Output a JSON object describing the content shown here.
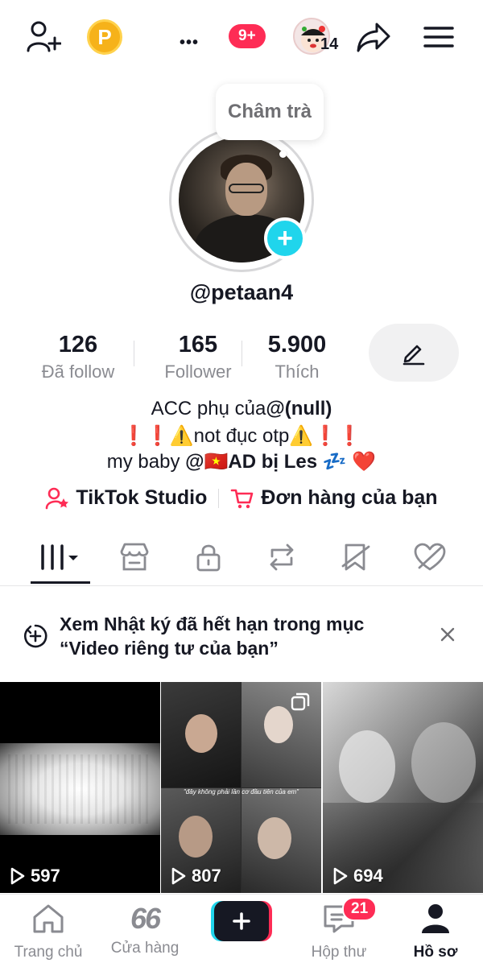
{
  "topbar": {
    "coin_letter": "P",
    "more_label": "•••",
    "notif_badge": "9+",
    "story_count": "14"
  },
  "profile": {
    "bubble_text": "Châm trà",
    "username": "@petaan4"
  },
  "stats": [
    {
      "value": "126",
      "label": "Đã follow"
    },
    {
      "value": "165",
      "label": "Follower"
    },
    {
      "value": "5.900",
      "label": "Thích"
    }
  ],
  "bio": {
    "line1_text": "ACC phụ của",
    "line1_bold": "@(null)",
    "line2": "❗❗⚠️not đục otp⚠️❗❗",
    "line3_text": "my baby ",
    "line3_bold": "@🇻🇳AD bị Les",
    "line3_suffix": " 💤 ❤️"
  },
  "links": {
    "studio": "TikTok Studio",
    "orders": "Đơn hàng của bạn"
  },
  "tabs": [
    "videos-grid",
    "shop",
    "private",
    "reposts",
    "favorites",
    "liked"
  ],
  "banner": {
    "text": "Xem Nhật ký đã hết hạn trong mục “Video riêng tư của bạn”"
  },
  "videos": [
    {
      "views": "597"
    },
    {
      "views": "807"
    },
    {
      "views": "694"
    }
  ],
  "video_caption": "\"đây không phải lần cơ đầu tiên của em\"",
  "nav": {
    "home": "Trang chủ",
    "shop": "Cửa hàng",
    "shop_logo": "66",
    "inbox": "Hộp thư",
    "inbox_badge": "21",
    "profile": "Hồ sơ"
  },
  "colors": {
    "accent_red": "#fe2c55",
    "accent_cyan": "#20d5ec",
    "coin": "#f6b21a"
  }
}
